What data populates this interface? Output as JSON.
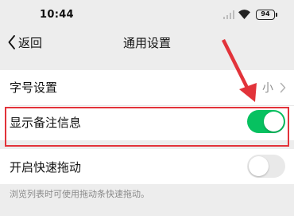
{
  "status_bar": {
    "time": "10:44",
    "battery_level": "94",
    "icons": [
      "signal-icon",
      "wifi-icon",
      "battery-icon"
    ]
  },
  "nav": {
    "back_label": "返回",
    "title": "通用设置"
  },
  "settings": {
    "font_size": {
      "label": "字号设置",
      "value": "小"
    },
    "show_remark": {
      "label": "显示备注信息",
      "enabled": true
    },
    "quick_drag": {
      "label": "开启快速拖动",
      "enabled": false,
      "hint": "浏览列表时可使用拖动条快速拖动。"
    }
  },
  "colors": {
    "accent_green": "#07c160",
    "annotation_red": "#e2333a",
    "background": "#ededed"
  }
}
